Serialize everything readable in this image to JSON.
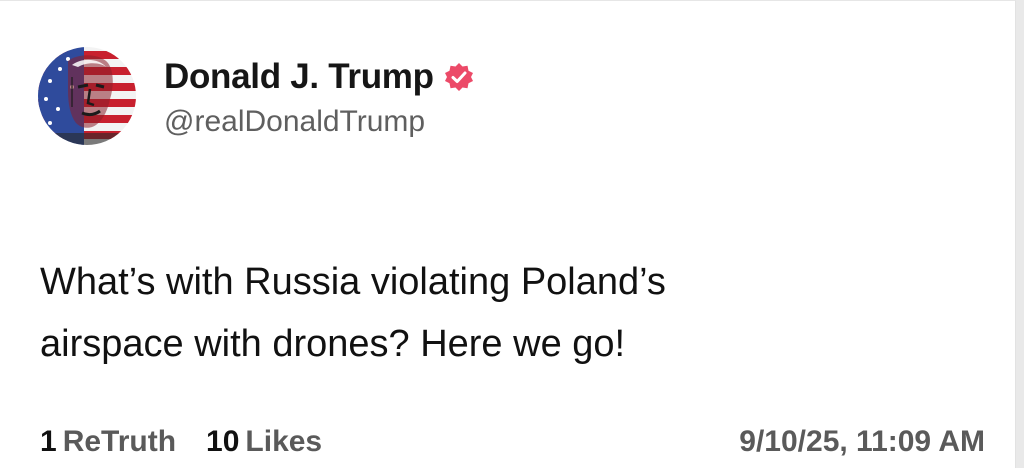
{
  "profile": {
    "display_name": "Donald J. Trump",
    "handle": "@realDonaldTrump",
    "avatar_icon": "flag-portrait-avatar",
    "verified_icon": "verified-badge-icon",
    "verified_color": "#ec4a68"
  },
  "post": {
    "text_lines": [
      "What’s with Russia violating Poland’s",
      "airspace with drones? Here we go!"
    ]
  },
  "stats": {
    "retruths_count": "1",
    "retruths_label": "ReTruth",
    "likes_count": "10",
    "likes_label": "Likes"
  },
  "timestamp": "9/10/25, 11:09 AM"
}
